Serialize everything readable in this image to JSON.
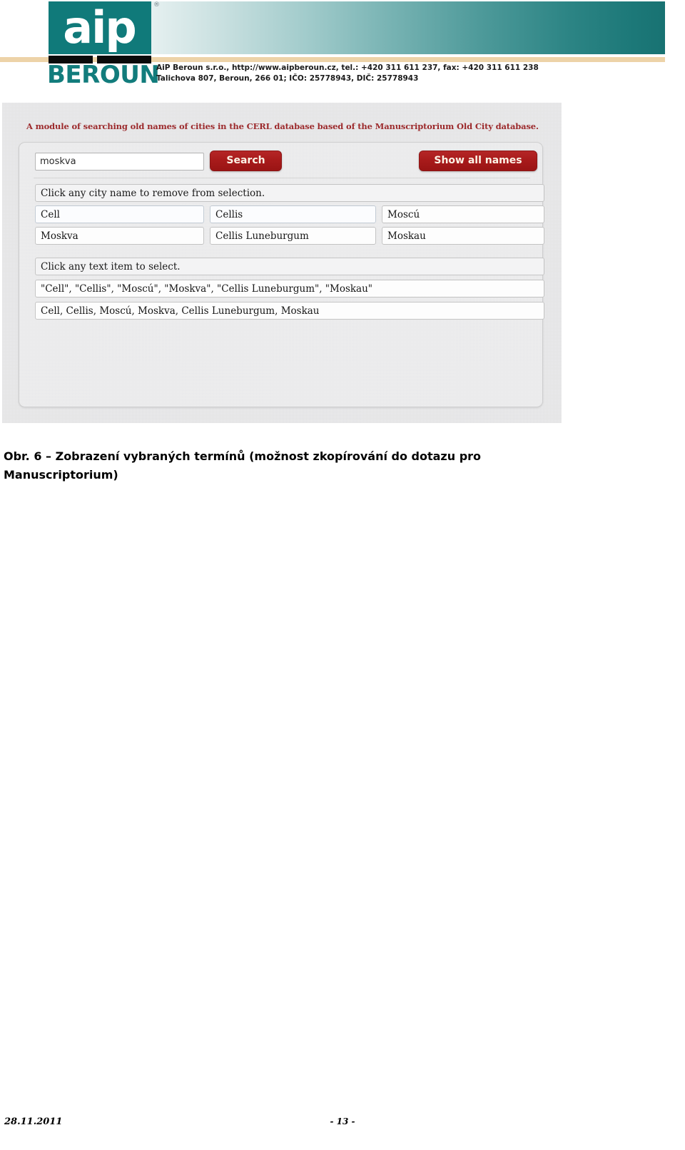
{
  "letterhead": {
    "logo_mark": "aip",
    "logo_trademark": "®",
    "logo_wordmark": "BEROUN",
    "company_line1": "AiP Beroun s.r.o., http://www.aipberoun.cz, tel.: +420 311 611 237, fax: +420 311 611 238",
    "company_line2": "Talichova 807, Beroun, 266 01; IČO: 25778943, DIČ: 25778943",
    "brand_teal": "#107a7a",
    "brand_tan": "#edd3a8"
  },
  "figure": {
    "title": "A module of searching old names of cities in the CERL database based of the Manuscriptorium Old City database.",
    "title_color": "#9c2a2c",
    "search": {
      "value": "moskva",
      "placeholder": "",
      "search_button": "Search",
      "show_all_button": "Show all names",
      "button_color": "#a81b1b"
    },
    "city_section": {
      "hint": "Click any city name to remove from selection.",
      "rows": [
        [
          "Cell",
          "Cellis",
          "Moscú"
        ],
        [
          "Moskva",
          "Cellis Luneburgum",
          "Moskau"
        ]
      ]
    },
    "text_section": {
      "hint": "Click any text item to select.",
      "items": [
        "\"Cell\", \"Cellis\", \"Moscú\", \"Moskva\", \"Cellis Luneburgum\", \"Moskau\"",
        "Cell, Cellis, Moscú, Moskva, Cellis Luneburgum, Moskau"
      ]
    }
  },
  "caption": {
    "line1": "Obr. 6 – Zobrazení vybraných termínů (možnost zkopírování do dotazu pro",
    "line2": "Manuscriptorium)"
  },
  "footer": {
    "date": "28.11.2011",
    "page": "- 13 -"
  }
}
